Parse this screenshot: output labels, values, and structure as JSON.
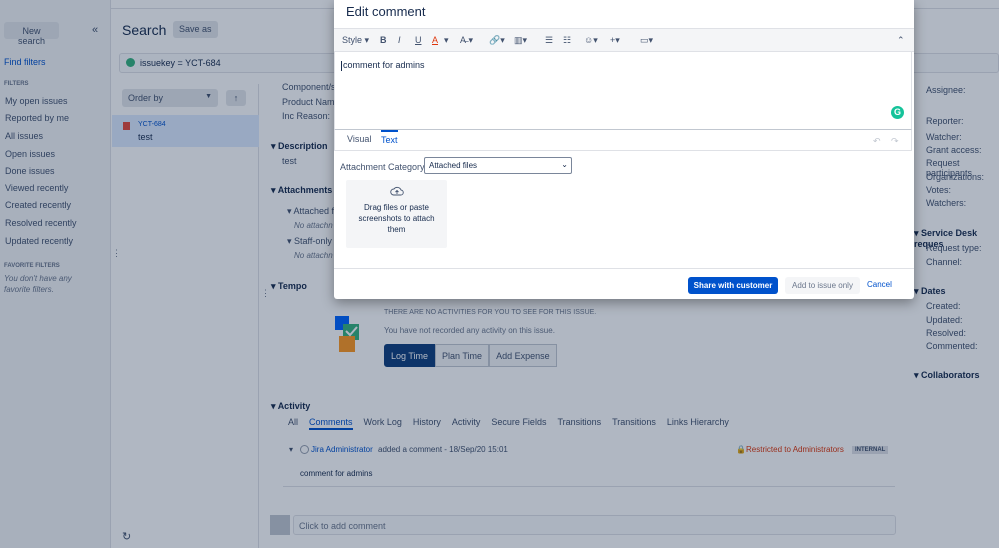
{
  "sidebar": {
    "new_search": "New search",
    "collapse": "«",
    "find_filters": "Find filters",
    "filters_heading": "FILTERS",
    "filters": [
      "My open issues",
      "Reported by me",
      "All issues",
      "Open issues",
      "Done issues",
      "Viewed recently",
      "Created recently",
      "Resolved recently",
      "Updated recently"
    ],
    "favorite_heading": "FAVORITE FILTERS",
    "favorite_note": "You don't have any favorite filters."
  },
  "search": {
    "title": "Search",
    "save_as": "Save as",
    "jql": "issuekey = YCT-684"
  },
  "list": {
    "order_by": "Order by",
    "item": {
      "key": "YCT-684",
      "summary": "test"
    }
  },
  "detail": {
    "fields": [
      "Component/s:",
      "Product Name",
      "Inc Reason:"
    ],
    "description_heading": "Description",
    "description": "test",
    "attachments_heading": "Attachments",
    "attached_files": "Attached f",
    "no_attach_1": "No attachn",
    "staff_only": "Staff-only",
    "no_attach_2": "No attachn",
    "tempo_heading": "Tempo",
    "tempo_msg": "THERE ARE NO ACTIVITIES FOR YOU TO SEE FOR THIS ISSUE.",
    "tempo_msg2": "You have not recorded any activity on this issue.",
    "log_time": "Log Time",
    "plan_time": "Plan Time",
    "add_expense": "Add Expense",
    "activity_heading": "Activity",
    "activity_tabs": [
      "All",
      "Comments",
      "Work Log",
      "History",
      "Activity",
      "Secure Fields",
      "Transitions",
      "Transitions",
      "Links Hierarchy"
    ],
    "comment_author": "Jira Administrator",
    "comment_meta": "added a comment - 18/Sep/20 15:01",
    "restricted": "Restricted to Administrators",
    "internal": "INTERNAL",
    "comment_body": "comment for admins",
    "add_comment_placeholder": "Click to add comment"
  },
  "right_panel": {
    "assignee": "Assignee:",
    "reporter": "Reporter:",
    "watcher": "Watcher:",
    "grant_access": "Grant access:",
    "request_participants": "Request participants",
    "organizations": "Organizations:",
    "votes": "Votes:",
    "watchers": "Watchers:",
    "service_desk": "Service Desk reques",
    "request_type": "Request type:",
    "channel": "Channel:",
    "dates": "Dates",
    "created": "Created:",
    "updated": "Updated:",
    "resolved": "Resolved:",
    "commented": "Commented:",
    "collaborators": "Collaborators"
  },
  "modal": {
    "title": "Edit comment",
    "style": "Style",
    "editor_text": "comment for admins",
    "tab_visual": "Visual",
    "tab_text": "Text",
    "attachment_category_label": "Attachment Category",
    "attachment_category_value": "Attached files",
    "dropzone_text": "Drag files or paste screenshots to attach them",
    "share_button": "Share with customer",
    "add_only_button": "Add to issue only",
    "cancel": "Cancel"
  },
  "colors": {
    "primary": "#0052cc",
    "restricted": "#de350b",
    "tempo_button": "#0f3e7c"
  }
}
